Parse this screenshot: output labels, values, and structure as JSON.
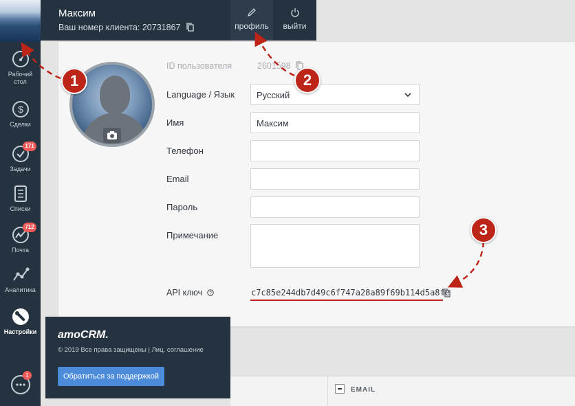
{
  "header": {
    "user_name": "Максим",
    "client_number": "Ваш номер клиента: 20731867",
    "profile_label": "профиль",
    "logout_label": "выйти"
  },
  "sidebar": {
    "items": [
      {
        "label_line1": "Рабочий",
        "label_line2": "стол",
        "icon": "dashboard-icon"
      },
      {
        "label": "Сделки",
        "icon": "dollar-icon"
      },
      {
        "label": "Задачи",
        "icon": "tasks-check-icon",
        "badge": "171"
      },
      {
        "label": "Списки",
        "icon": "lists-icon"
      },
      {
        "label": "Почта",
        "icon": "mail-icon",
        "badge": "712"
      },
      {
        "label": "Аналитика",
        "icon": "analytics-icon"
      },
      {
        "label": "Настройки",
        "icon": "wrench-icon",
        "active": true
      }
    ],
    "chat_badge": "1"
  },
  "form": {
    "user_id_label": "ID пользователя",
    "user_id_value": "2601598",
    "language_label": "Language / Язык",
    "language_value": "Русский",
    "name_label": "Имя",
    "name_value": "Максим",
    "phone_label": "Телефон",
    "phone_value": "",
    "email_label": "Email",
    "email_value": "",
    "password_label": "Пароль",
    "password_value": "",
    "note_label": "Примечание",
    "note_value": "",
    "api_label": "API ключ",
    "api_key": "c7c85e244db7d49c6f747a28a89f69b114d5a8fe"
  },
  "footer": {
    "logo": "amoCRM.",
    "copyright": "© 2019 Все права защищены | Лиц. соглашение",
    "support_button": "Обратиться за поддержкой"
  },
  "bottom": {
    "email_header": "EMAIL"
  },
  "annotations": {
    "step1": "1",
    "step2": "2",
    "step3": "3",
    "color": "#bd2519"
  },
  "colors": {
    "sidebar_bg": "#253341",
    "accent_blue": "#4c8bd9",
    "badge_red": "#f25a5a"
  }
}
